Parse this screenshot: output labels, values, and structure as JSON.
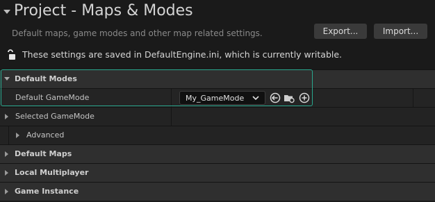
{
  "header": {
    "title": "Project - Maps & Modes",
    "subtitle": "Default maps, game modes and other map related settings.",
    "export_label": "Export...",
    "import_label": "Import...",
    "notice": "These settings are saved in DefaultEngine.ini, which is currently writable."
  },
  "sections": {
    "default_modes": {
      "label": "Default Modes",
      "default_gamemode_label": "Default GameMode",
      "default_gamemode_value": "My_GameMode",
      "selected_gamemode_label": "Selected GameMode",
      "advanced_label": "Advanced"
    },
    "default_maps": {
      "label": "Default Maps"
    },
    "local_multiplayer": {
      "label": "Local Multiplayer"
    },
    "game_instance": {
      "label": "Game Instance"
    }
  },
  "colors": {
    "focus_outline": "#29a88e",
    "background": "#1a1a1a",
    "category_row": "#2f2f2f"
  },
  "icons": [
    "collapse-arrow-icon",
    "unlock-icon",
    "chevron-down-icon",
    "use-selected-icon",
    "browse-icon",
    "add-icon"
  ]
}
